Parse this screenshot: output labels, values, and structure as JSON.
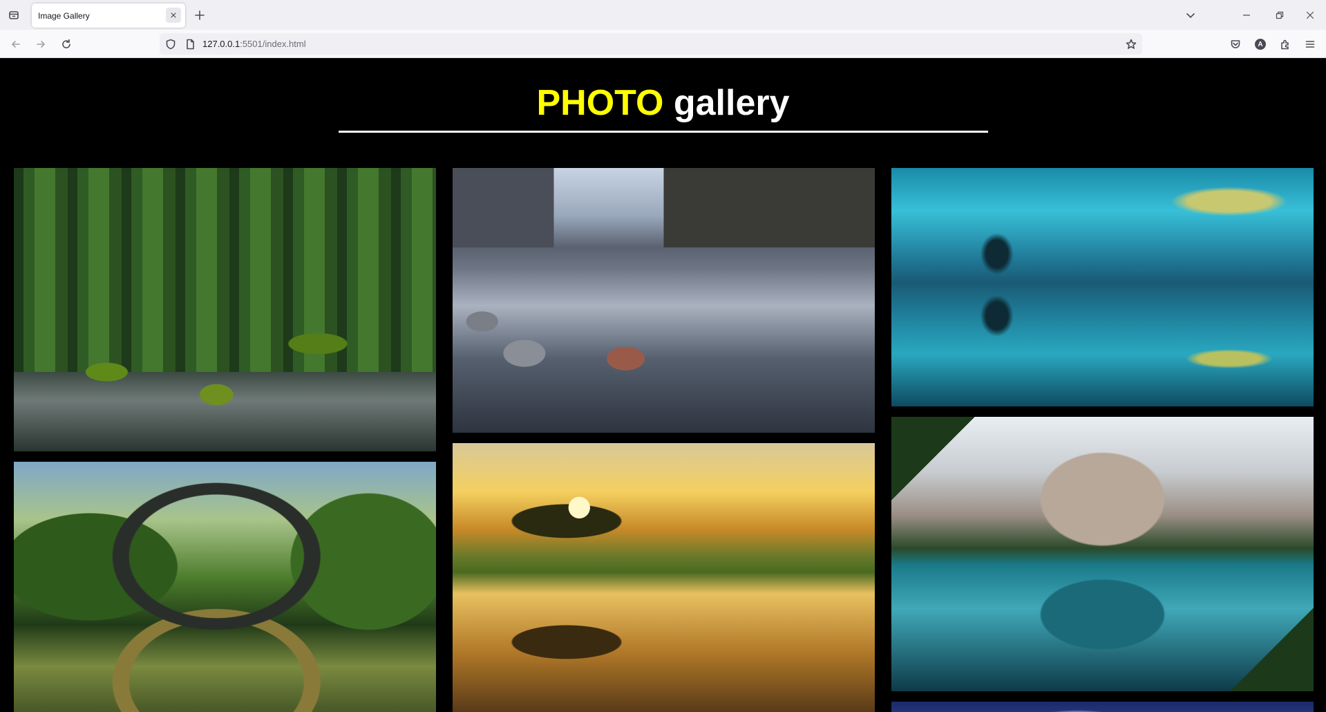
{
  "browser": {
    "tab_title": "Image Gallery",
    "url_host": "127.0.0.1",
    "url_path": ":5501/index.html",
    "profile_initial": "A"
  },
  "page": {
    "title_accent": "PHOTO",
    "title_rest": " gallery",
    "accent_color": "#ffff00",
    "background_color": "#000000"
  },
  "gallery": {
    "columns": 3,
    "photos": [
      {
        "subject": "forest stream with mossy rocks"
      },
      {
        "subject": "stone arch bridge reflected in lake"
      },
      {
        "subject": "alpine valley river with rocks"
      },
      {
        "subject": "tree sunset reflected in pond"
      },
      {
        "subject": "lone tree in turquoise lake"
      },
      {
        "subject": "mountain lake with pine trees"
      },
      {
        "subject": "blue night sky"
      }
    ]
  }
}
